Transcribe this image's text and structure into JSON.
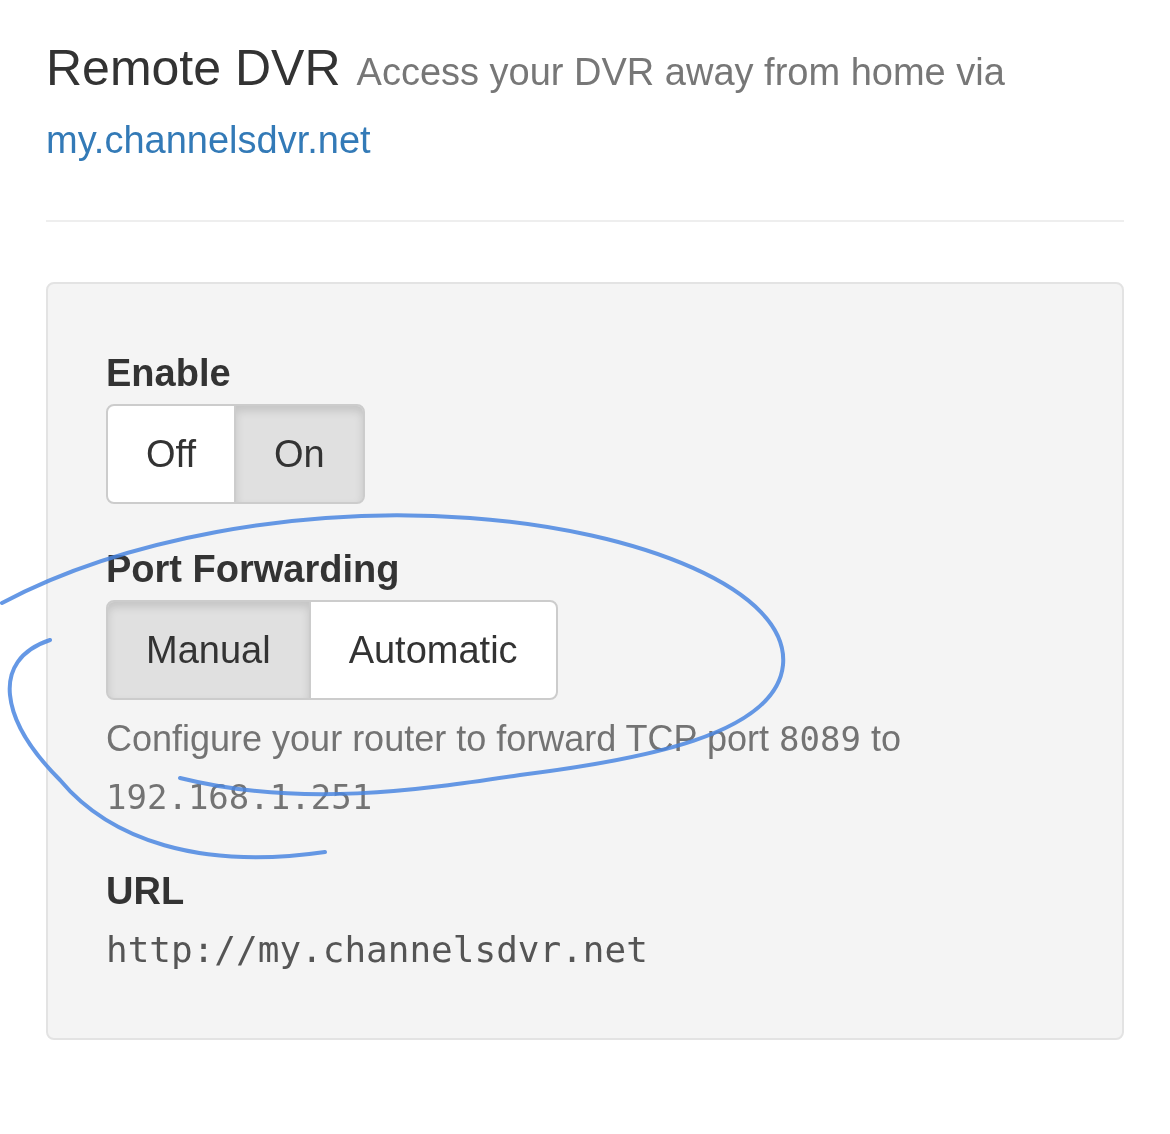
{
  "header": {
    "title": "Remote DVR",
    "subtitle": "Access your DVR away from home via",
    "link": "my.channelsdvr.net"
  },
  "settings": [
    {
      "kind": "toggle",
      "label": "Enable",
      "options": [
        {
          "label": "Off",
          "selected": false
        },
        {
          "label": "On",
          "selected": true
        }
      ]
    },
    {
      "kind": "toggle",
      "label": "Port Forwarding",
      "options": [
        {
          "label": "Manual",
          "selected": true
        },
        {
          "label": "Automatic",
          "selected": false
        }
      ],
      "help": [
        {
          "kind": "plain",
          "text": "Configure your router to forward TCP port "
        },
        {
          "kind": "code",
          "text": "8089"
        },
        {
          "kind": "plain",
          "text": " to "
        },
        {
          "kind": "code",
          "text": "192.168.1.251"
        }
      ]
    },
    {
      "kind": "value",
      "label": "URL",
      "value": "http://my.channelsdvr.net"
    }
  ]
}
